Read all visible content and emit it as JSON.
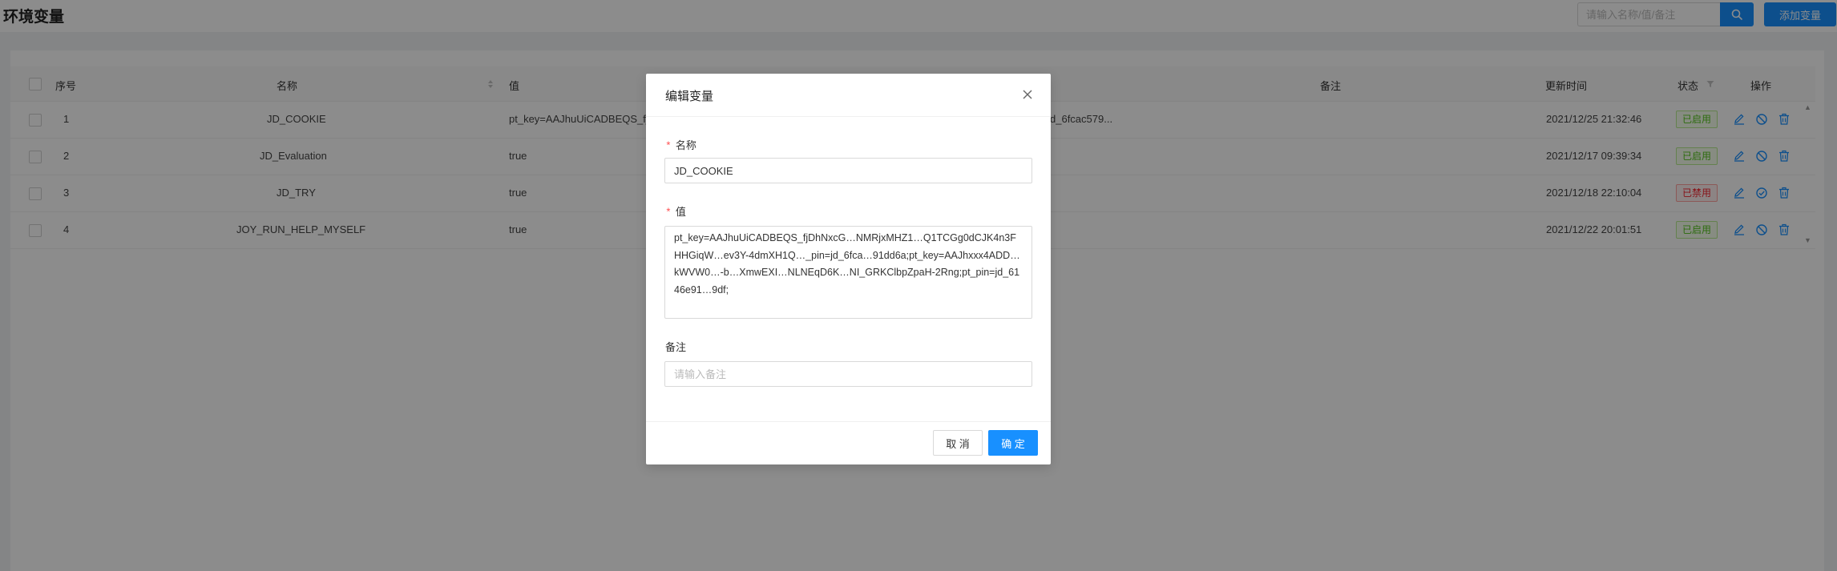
{
  "header": {
    "title": "环境变量",
    "search_placeholder": "请输入名称/值/备注",
    "add_button": "添加变量"
  },
  "table": {
    "columns": {
      "index": "序号",
      "name": "名称",
      "value": "值",
      "remark": "备注",
      "updated": "更新时间",
      "status": "状态",
      "actions": "操作"
    },
    "rows": [
      {
        "index": "1",
        "name": "JD_COOKIE",
        "value": "pt_key=AAJhuUiCADBEQS_fj",
        "value_tail": "d_6fcac579...",
        "updated": "2021/12/25 21:32:46",
        "status": "已启用",
        "enabled": true
      },
      {
        "index": "2",
        "name": "JD_Evaluation",
        "value": "true",
        "value_tail": "",
        "updated": "2021/12/17 09:39:34",
        "status": "已启用",
        "enabled": true
      },
      {
        "index": "3",
        "name": "JD_TRY",
        "value": "true",
        "value_tail": "",
        "updated": "2021/12/18 22:10:04",
        "status": "已禁用",
        "enabled": false
      },
      {
        "index": "4",
        "name": "JOY_RUN_HELP_MYSELF",
        "value": "true",
        "value_tail": "",
        "updated": "2021/12/22 20:01:51",
        "status": "已启用",
        "enabled": true
      }
    ]
  },
  "modal": {
    "title": "编辑变量",
    "name_label": "名称",
    "name_value": "JD_COOKIE",
    "value_label": "值",
    "value_text": "pt_key=AAJhuUiCADBEQS_fjDhNxcG…NMRjxMHZ1…Q1TCGg0dCJK4n3FHHGiqW…ev3Y-4dmXH1Q…_pin=jd_6fca…91dd6a;pt_key=AAJhxxx4ADD…kWVW0…-b…XmwEXI…NLNEqD6K…NI_GRKClbpZpaH-2Rng;pt_pin=jd_6146e91…9df;",
    "remark_label": "备注",
    "remark_placeholder": "请输入备注",
    "cancel": "取 消",
    "ok": "确 定"
  },
  "colors": {
    "primary": "#1890ff",
    "enabled": "#52c41a",
    "disabled": "#f5222d"
  }
}
